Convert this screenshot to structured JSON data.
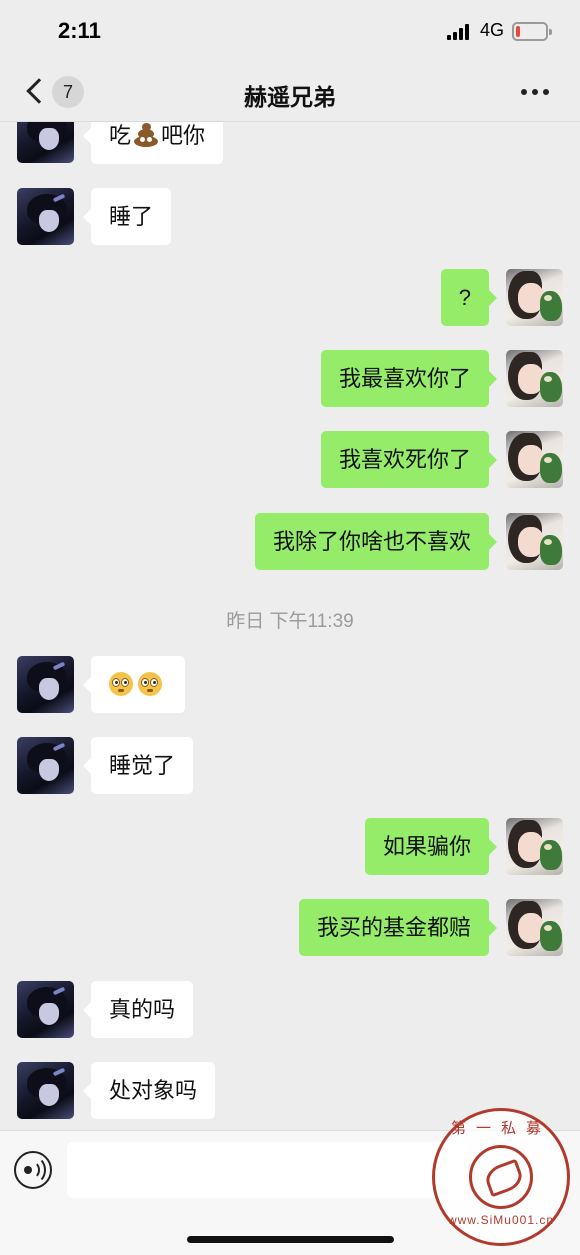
{
  "status_bar": {
    "time": "2:11",
    "network": "4G",
    "battery_level": 0.15,
    "battery_color": "#e84a3c"
  },
  "nav": {
    "unread_count": "7",
    "title": "赫遥兄弟",
    "more_icon": "more-dots-icon"
  },
  "messages": [
    {
      "side": "in",
      "text_before": "吃",
      "emoji": "poop",
      "text_after": "吧你"
    },
    {
      "side": "in",
      "text": "睡了"
    },
    {
      "side": "out",
      "text": "?"
    },
    {
      "side": "out",
      "text": "我最喜欢你了"
    },
    {
      "side": "out",
      "text": "我喜欢死你了"
    },
    {
      "side": "out",
      "text": "我除了你啥也不喜欢"
    },
    {
      "timestamp": "昨日 下午11:39"
    },
    {
      "side": "in",
      "emoji": "flushed-face x2"
    },
    {
      "side": "in",
      "text": "睡觉了"
    },
    {
      "side": "out",
      "text": "如果骗你"
    },
    {
      "side": "out",
      "text": "我买的基金都赔"
    },
    {
      "side": "in",
      "text": "真的吗"
    },
    {
      "side": "in",
      "text": "处对象吗"
    }
  ],
  "input": {
    "value": "",
    "voice_icon": "voice-icon"
  },
  "watermark": {
    "top_text": "第一私募",
    "bottom_text": "www.SiMu001.cn"
  },
  "colors": {
    "background": "#ededed",
    "outgoing_bubble": "#95ec69",
    "incoming_bubble": "#ffffff",
    "stamp": "#b23a2c"
  }
}
